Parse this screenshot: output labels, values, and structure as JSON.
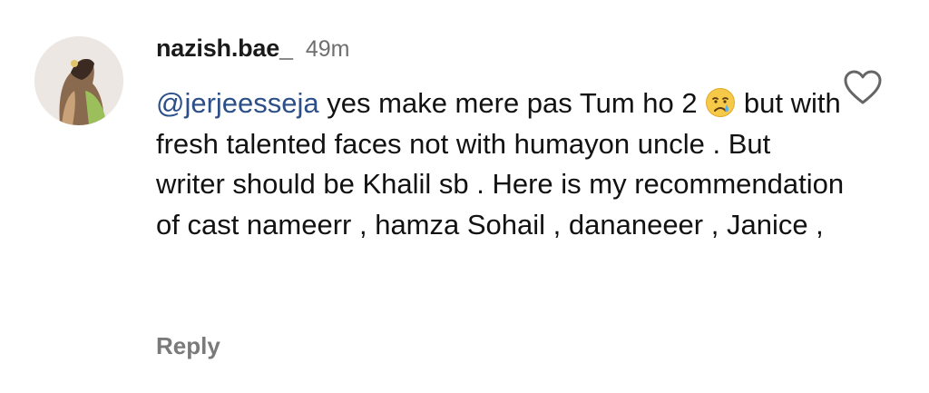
{
  "comment": {
    "username": "nazish.bae_",
    "time": "49m",
    "mention": "@jerjeesseja",
    "text_part1": " yes make mere pas Tum ho 2 ",
    "emoji": "crying-face",
    "text_part2": " but with fresh talented faces not with humayon uncle . But writer should be Khalil sb . Here is my recommendation of cast nameerr , hamza Sohail , dananeeer , Janice ,",
    "reply_label": "Reply",
    "like_icon": "heart-outline-icon"
  },
  "colors": {
    "mention": "#2c4f8a",
    "text": "#121212",
    "muted": "#7a7a7a"
  }
}
